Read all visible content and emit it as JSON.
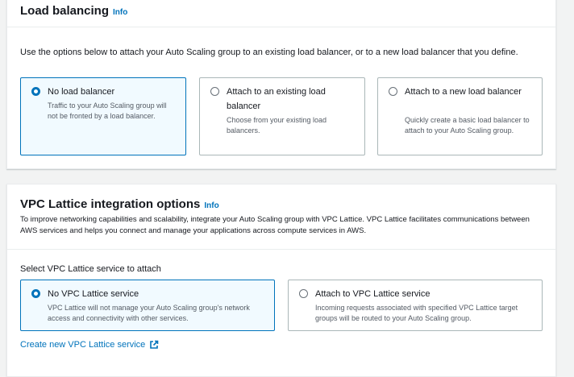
{
  "load_balancing": {
    "title": "Load balancing",
    "info": "Info",
    "description": "Use the options below to attach your Auto Scaling group to an existing load balancer, or to a new load balancer that you define.",
    "options": [
      {
        "label": "No load balancer",
        "description": "Traffic to your Auto Scaling group will not be fronted by a load balancer.",
        "selected": true
      },
      {
        "label": "Attach to an existing load balancer",
        "description": "Choose from your existing load balancers.",
        "selected": false
      },
      {
        "label": "Attach to a new load balancer",
        "description": "Quickly create a basic load balancer to attach to your Auto Scaling group.",
        "selected": false
      }
    ]
  },
  "vpc_lattice": {
    "title": "VPC Lattice integration options",
    "info": "Info",
    "description": "To improve networking capabilities and scalability, integrate your Auto Scaling group with VPC Lattice. VPC Lattice facilitates communications between AWS services and helps you connect and manage your applications across compute services in AWS.",
    "field_label": "Select VPC Lattice service to attach",
    "options": [
      {
        "label": "No VPC Lattice service",
        "description": "VPC Lattice will not manage your Auto Scaling group's network access and connectivity with other services.",
        "selected": true
      },
      {
        "label": "Attach to VPC Lattice service",
        "description": "Incoming requests associated with specified VPC Lattice target groups will be routed to your Auto Scaling group.",
        "selected": false
      }
    ],
    "create_link": "Create new VPC Lattice service"
  },
  "colors": {
    "accent": "#0073bb",
    "selected_bg": "#f1faff",
    "page_bg": "#f2f3f3"
  }
}
